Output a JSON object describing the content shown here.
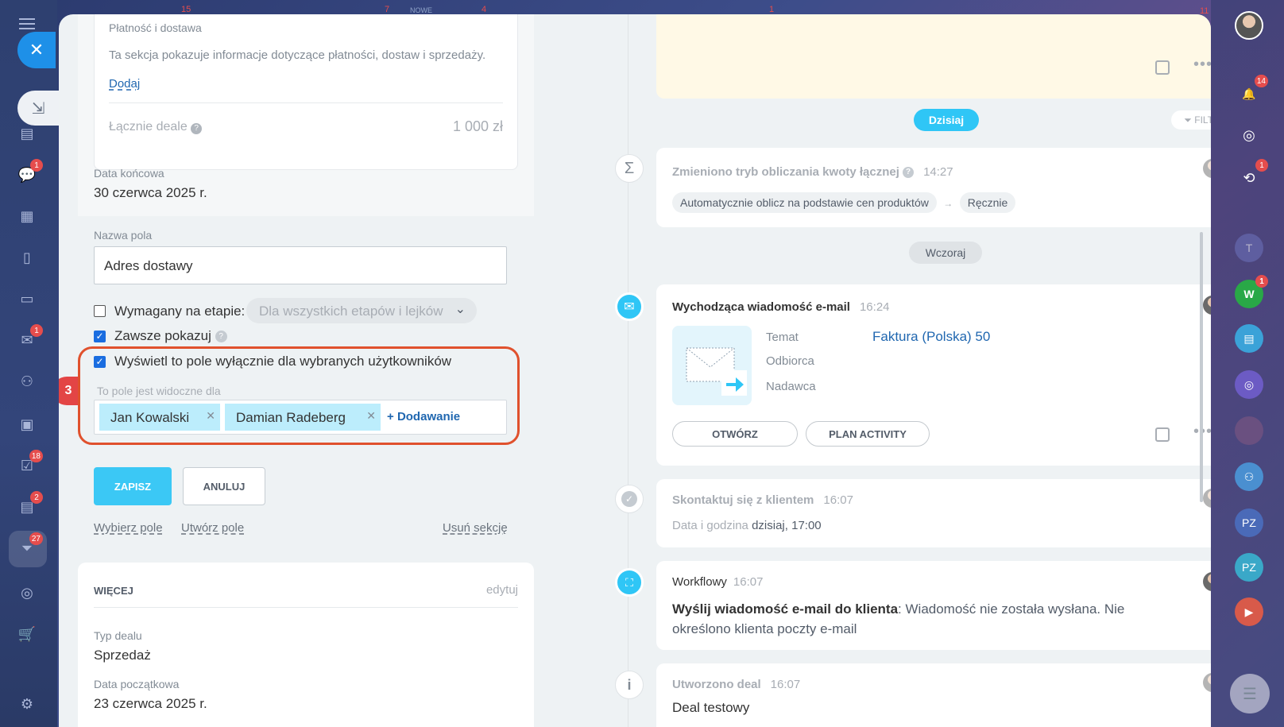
{
  "left_sidebar": {
    "badges": {
      "chat": "1",
      "mail": "1",
      "tasks": "18",
      "feed": "2",
      "crm": "27"
    }
  },
  "right_sidebar": {
    "badges": {
      "notifications": "14",
      "sync": "1",
      "w_avatar": "1"
    },
    "avatars": {
      "w": "W",
      "pz1": "PZ",
      "pz2": "PZ",
      "t": "T"
    }
  },
  "top_bar_faded": {
    "n1": "15",
    "n2": "7",
    "nowe": "NOWE",
    "n3": "4",
    "n4": "1",
    "n5": "11"
  },
  "payment": {
    "title": "Płatność i dostawa",
    "description": "Ta sekcja pokazuje informacje dotyczące płatności, dostaw i sprzedaży.",
    "add_link": "Dodaj",
    "total_label": "Łącznie deale",
    "total_value": "1 000 zł"
  },
  "end_date": {
    "label": "Data końcowa",
    "value": "30 czerwca 2025 r."
  },
  "field_editor": {
    "name_label": "Nazwa pola",
    "name_value": "Adres dostawy",
    "required_label": "Wymagany na etapie:",
    "required_select": "Dla wszystkich etapów i lejków",
    "always_show_label": "Zawsze pokazuj",
    "restrict_label": "Wyświetl to pole wyłącznie dla wybranych użytkowników",
    "step_number": "3",
    "visible_for_label": "To pole jest widoczne dla",
    "users": [
      "Jan Kowalski",
      "Damian Radeberg"
    ],
    "add_user": "Dodawanie",
    "save": "ZAPISZ",
    "cancel": "ANULUJ",
    "choose_field": "Wybierz pole",
    "create_field": "Utwórz pole",
    "delete_section": "Usuń sekcję"
  },
  "more": {
    "title": "WIĘCEJ",
    "edit": "edytuj",
    "deal_type_label": "Typ dealu",
    "deal_type_value": "Sprzedaż",
    "start_date_label": "Data początkowa",
    "start_date_value": "23 czerwca 2025 r."
  },
  "timeline": {
    "today": "Dzisiaj",
    "filter": "FILTR",
    "yesterday": "Wczoraj",
    "item1": {
      "title": "Zmieniono tryb obliczania kwoty łącznej",
      "time": "14:27",
      "from": "Automatycznie oblicz na podstawie cen produktów",
      "to": "Ręcznie"
    },
    "item2": {
      "title": "Wychodząca wiadomość e-mail",
      "time": "16:24",
      "subject_label": "Temat",
      "subject_value": "Faktura (Polska) 50",
      "recipient_label": "Odbiorca",
      "sender_label": "Nadawca",
      "open_btn": "OTWÓRZ",
      "plan_btn": "PLAN ACTIVITY"
    },
    "item3": {
      "title": "Skontaktuj się z klientem",
      "time": "16:07",
      "datetime_label": "Data i godzina",
      "datetime_value": "dzisiaj, 17:00"
    },
    "item4": {
      "title": "Workflowy",
      "time": "16:07",
      "bold": "Wyślij wiadomość e-mail do klienta",
      "text": ": Wiadomość nie została wysłana. Nie określono klienta poczty e-mail"
    },
    "item5": {
      "title": "Utworzono deal",
      "time": "16:07",
      "text": "Deal testowy"
    }
  },
  "colors": {
    "accent": "#2fc6f6",
    "highlight": "#e0512d",
    "user_chip": "#bcedfc",
    "link": "#2067b0",
    "note_bg": "#fff9e6"
  }
}
